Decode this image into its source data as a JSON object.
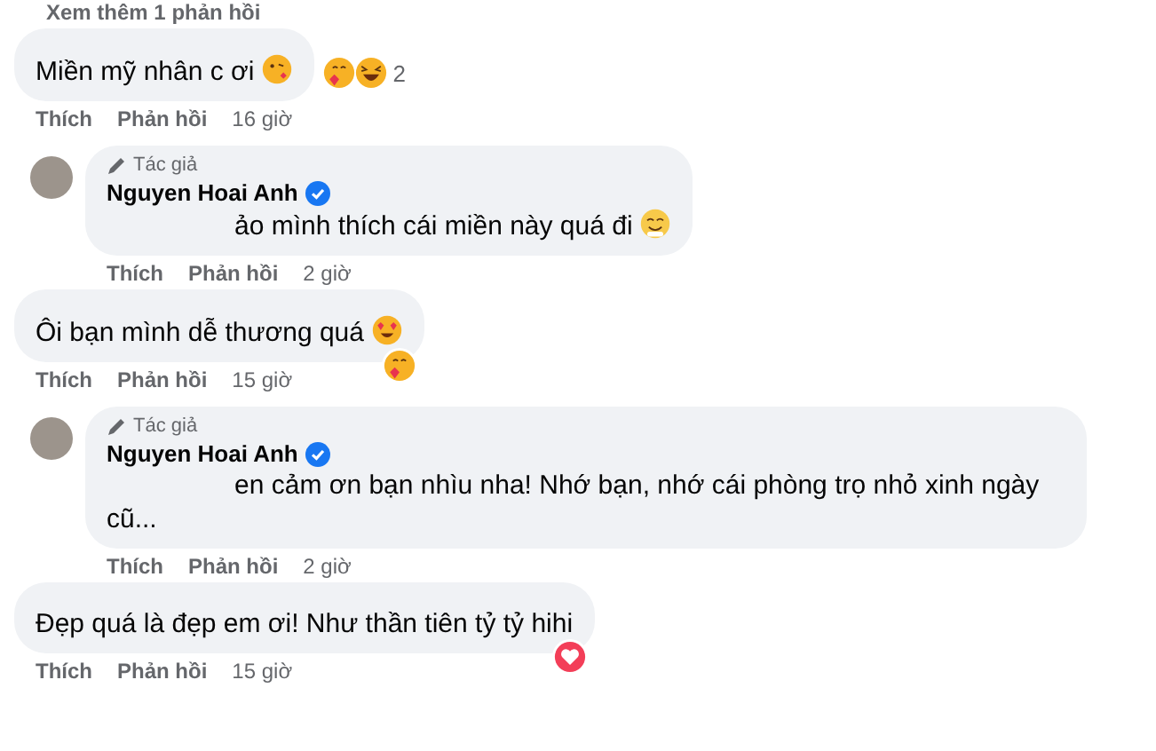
{
  "more_replies": {
    "label": "Xem thêm 1 phản hồi"
  },
  "comments": [
    {
      "kind": "comment",
      "text": "Miền mỹ nhân c ơi",
      "text_emoji": {
        "kind": "kiss"
      },
      "reactions": {
        "items": [
          {
            "kind": "hug"
          },
          {
            "kind": "laugh"
          }
        ],
        "count": "2"
      },
      "actions": [
        "Thích",
        "Phản hồi"
      ],
      "time": "16 giờ"
    },
    {
      "kind": "reply",
      "badge": "Tác giả",
      "author": "Nguyen Hoai Anh",
      "verified": true,
      "text": "ảo mình thích cái miền này quá đi",
      "text_emoji": {
        "kind": "smile"
      },
      "actions": [
        "Thích",
        "Phản hồi"
      ],
      "time": "2 giờ"
    },
    {
      "kind": "comment",
      "text": "Ôi bạn mình dễ thương quá",
      "text_emoji": {
        "kind": "hearteyes"
      },
      "reactions": {
        "items": [
          {
            "kind": "hug"
          }
        ]
      },
      "actions": [
        "Thích",
        "Phản hồi"
      ],
      "time": "15 giờ"
    },
    {
      "kind": "reply",
      "badge": "Tác giả",
      "author": "Nguyen Hoai Anh",
      "verified": true,
      "text": "en cảm ơn bạn nhìu nha! Nhớ bạn, nhớ cái phòng trọ nhỏ xinh ngày cũ...",
      "actions": [
        "Thích",
        "Phản hồi"
      ],
      "time": "2 giờ"
    },
    {
      "kind": "comment",
      "text": "Đẹp quá là đẹp em ơi! Như thần tiên tỷ tỷ hihi",
      "reactions": {
        "items": [
          {
            "kind": "love"
          }
        ]
      },
      "actions": [
        "Thích",
        "Phản hồi"
      ],
      "time": "15 giờ"
    }
  ]
}
